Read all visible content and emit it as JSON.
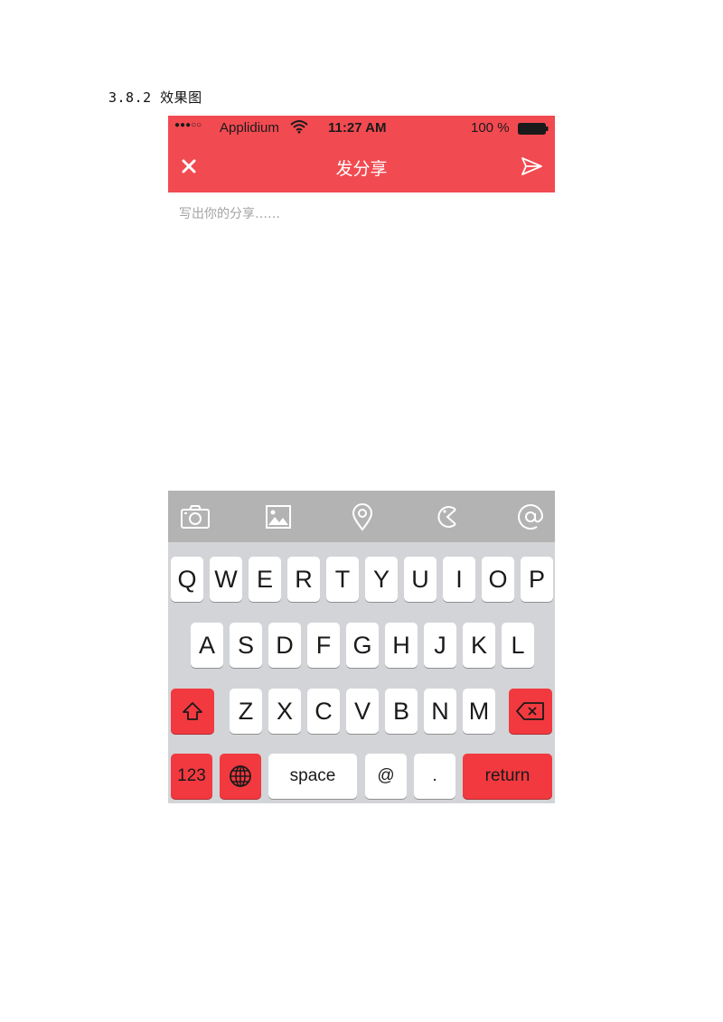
{
  "document": {
    "heading": "3.8.2 效果图"
  },
  "status_bar": {
    "signal": "●●●○○",
    "carrier": "Applidium",
    "time": "11:27 AM",
    "battery": "100 %",
    "icons": [
      "wifi-icon",
      "battery-icon"
    ]
  },
  "nav": {
    "title": "发分享",
    "left_icon": "close-icon",
    "right_icon": "send-icon"
  },
  "compose": {
    "placeholder": "写出你的分享……",
    "value": ""
  },
  "toolbar": {
    "icons": [
      "camera-icon",
      "image-icon",
      "location-icon",
      "emoji-icon",
      "mention-icon"
    ]
  },
  "keyboard": {
    "row1": [
      "Q",
      "W",
      "E",
      "R",
      "T",
      "Y",
      "U",
      "I",
      "O",
      "P"
    ],
    "row2": [
      "A",
      "S",
      "D",
      "F",
      "G",
      "H",
      "J",
      "K",
      "L"
    ],
    "row3": [
      "Z",
      "X",
      "C",
      "V",
      "B",
      "N",
      "M"
    ],
    "shift_icon": "shift-icon",
    "delete_icon": "delete-icon",
    "numbers_label": "123",
    "globe_icon": "globe-icon",
    "space_label": "space",
    "at_label": "@",
    "period_label": ".",
    "return_label": "return"
  },
  "colors": {
    "accent": "#f24a51",
    "toolbar": "#b4b3b3",
    "keyboard_bg": "#d2d4d7",
    "key_red": "#f2393f"
  }
}
